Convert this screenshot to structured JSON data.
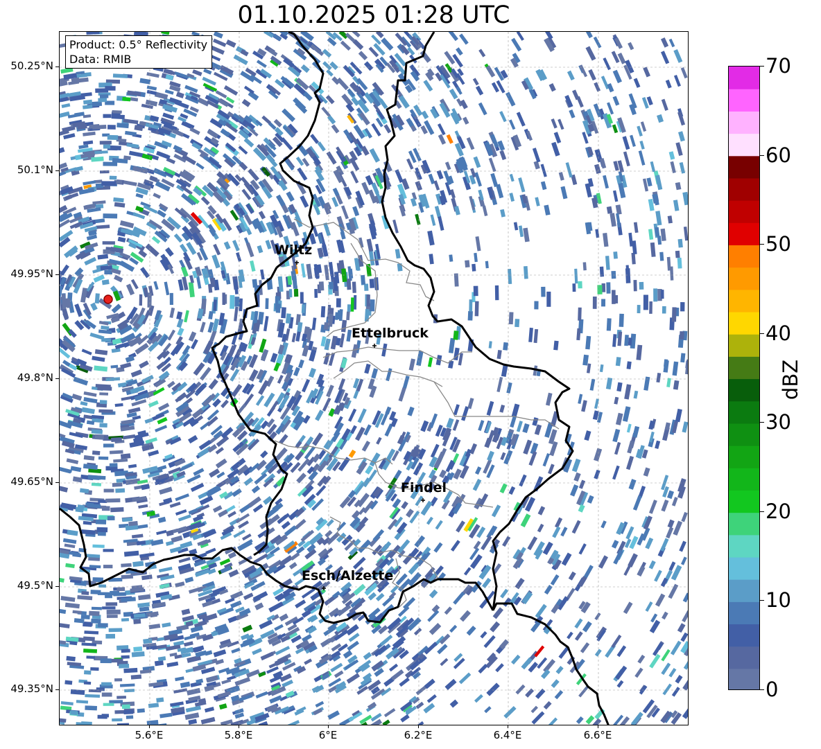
{
  "title": "01.10.2025 01:28 UTC",
  "info": {
    "product": "Product: 0.5° Reflectivity",
    "data": "Data: RMIB"
  },
  "lat_labels": [
    "50.25°N",
    "50.1°N",
    "49.95°N",
    "49.8°N",
    "49.65°N",
    "49.5°N",
    "49.35°N"
  ],
  "lon_labels": [
    "5.6°E",
    "5.8°E",
    "6°E",
    "6.2°E",
    "6.4°E",
    "6.6°E"
  ],
  "cities": [
    {
      "name": "Wiltz"
    },
    {
      "name": "Ettelbruck"
    },
    {
      "name": "Findel"
    },
    {
      "name": "Esch/Alzette"
    }
  ],
  "colorbar": {
    "label": "dBZ",
    "ticks": [
      "0",
      "10",
      "20",
      "30",
      "40",
      "50",
      "60",
      "70"
    ],
    "min": 0,
    "max": 70,
    "step": 2.5,
    "colors": [
      "#6577a6",
      "#5668a0",
      "#425fa6",
      "#4b7ab5",
      "#5b9dc8",
      "#64bfdc",
      "#5ed6c2",
      "#3ed37a",
      "#12c71f",
      "#12b61a",
      "#12a514",
      "#0f9012",
      "#0b7b10",
      "#085e0b",
      "#457b15",
      "#adb20b",
      "#ffd700",
      "#ffb500",
      "#ff9a00",
      "#ff7f00",
      "#e00000",
      "#c00000",
      "#a00000",
      "#780000",
      "#ffe0ff",
      "#ffb2ff",
      "#ff64ff",
      "#e22be6"
    ]
  },
  "radar_site_color": "#e8211c"
}
